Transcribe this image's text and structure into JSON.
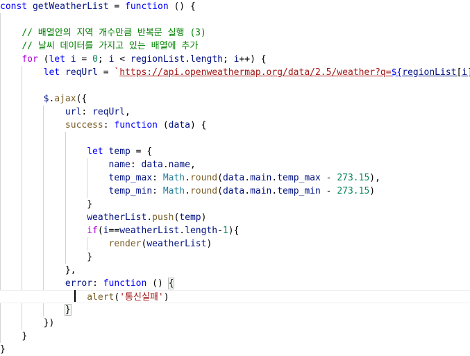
{
  "editor": {
    "lines": [
      [
        {
          "t": "const ",
          "c": "kw"
        },
        {
          "t": "getWeatherList",
          "c": "var"
        },
        {
          "t": " = ",
          "c": "pl"
        },
        {
          "t": "function",
          "c": "kw"
        },
        {
          "t": " () {",
          "c": "pl"
        }
      ],
      [],
      [
        {
          "t": "    "
        },
        {
          "t": "// 배열안의 지역 개수만큼 반복문 실행 (3)",
          "c": "cmt"
        }
      ],
      [
        {
          "t": "    "
        },
        {
          "t": "// 날씨 데이터를 가지고 있는 배열에 추가",
          "c": "cmt"
        }
      ],
      [
        {
          "t": "    "
        },
        {
          "t": "for",
          "c": "kw-ctrl"
        },
        {
          "t": " (",
          "c": "pl"
        },
        {
          "t": "let",
          "c": "kw"
        },
        {
          "t": " ",
          "c": "pl"
        },
        {
          "t": "i",
          "c": "var"
        },
        {
          "t": " = ",
          "c": "pl"
        },
        {
          "t": "0",
          "c": "num"
        },
        {
          "t": "; ",
          "c": "pl"
        },
        {
          "t": "i",
          "c": "var"
        },
        {
          "t": " < ",
          "c": "pl"
        },
        {
          "t": "regionList",
          "c": "var"
        },
        {
          "t": ".",
          "c": "pl"
        },
        {
          "t": "length",
          "c": "var"
        },
        {
          "t": "; ",
          "c": "pl"
        },
        {
          "t": "i",
          "c": "var"
        },
        {
          "t": "++) {",
          "c": "pl"
        }
      ],
      [
        {
          "t": "        "
        },
        {
          "t": "let",
          "c": "kw"
        },
        {
          "t": " ",
          "c": "pl"
        },
        {
          "t": "reqUrl",
          "c": "var"
        },
        {
          "t": " = ",
          "c": "pl"
        },
        {
          "t": "`",
          "c": "str"
        },
        {
          "t": "https://api.openweathermap.org/data/2.5/weather?q=",
          "c": "str url"
        },
        {
          "t": "${",
          "c": "tpl-expr url"
        },
        {
          "t": "regionList",
          "c": "var url"
        },
        {
          "t": "[",
          "c": "pl url"
        },
        {
          "t": "i",
          "c": "var url"
        },
        {
          "t": "]",
          "c": "pl url"
        },
        {
          "t": "}",
          "c": "tpl-expr url"
        }
      ],
      [],
      [
        {
          "t": "        "
        },
        {
          "t": "$",
          "c": "var"
        },
        {
          "t": ".",
          "c": "pl"
        },
        {
          "t": "ajax",
          "c": "fn"
        },
        {
          "t": "({",
          "c": "pl"
        }
      ],
      [
        {
          "t": "            "
        },
        {
          "t": "url",
          "c": "var"
        },
        {
          "t": ": ",
          "c": "pl"
        },
        {
          "t": "reqUrl",
          "c": "var"
        },
        {
          "t": ",",
          "c": "pl"
        }
      ],
      [
        {
          "t": "            "
        },
        {
          "t": "success",
          "c": "fn"
        },
        {
          "t": ": ",
          "c": "pl"
        },
        {
          "t": "function",
          "c": "kw"
        },
        {
          "t": " (",
          "c": "pl"
        },
        {
          "t": "data",
          "c": "var"
        },
        {
          "t": ") {",
          "c": "pl"
        }
      ],
      [],
      [
        {
          "t": "                "
        },
        {
          "t": "let",
          "c": "kw"
        },
        {
          "t": " ",
          "c": "pl"
        },
        {
          "t": "temp",
          "c": "var"
        },
        {
          "t": " = {",
          "c": "pl"
        }
      ],
      [
        {
          "t": "                    "
        },
        {
          "t": "name",
          "c": "var"
        },
        {
          "t": ": ",
          "c": "pl"
        },
        {
          "t": "data",
          "c": "var"
        },
        {
          "t": ".",
          "c": "pl"
        },
        {
          "t": "name",
          "c": "var"
        },
        {
          "t": ",",
          "c": "pl"
        }
      ],
      [
        {
          "t": "                    "
        },
        {
          "t": "temp_max",
          "c": "var"
        },
        {
          "t": ": ",
          "c": "pl"
        },
        {
          "t": "Math",
          "c": "cls"
        },
        {
          "t": ".",
          "c": "pl"
        },
        {
          "t": "round",
          "c": "fn"
        },
        {
          "t": "(",
          "c": "pl"
        },
        {
          "t": "data",
          "c": "var"
        },
        {
          "t": ".",
          "c": "pl"
        },
        {
          "t": "main",
          "c": "var"
        },
        {
          "t": ".",
          "c": "pl"
        },
        {
          "t": "temp_max",
          "c": "var"
        },
        {
          "t": " - ",
          "c": "pl"
        },
        {
          "t": "273.15",
          "c": "num"
        },
        {
          "t": "),",
          "c": "pl"
        }
      ],
      [
        {
          "t": "                    "
        },
        {
          "t": "temp_min",
          "c": "var"
        },
        {
          "t": ": ",
          "c": "pl"
        },
        {
          "t": "Math",
          "c": "cls"
        },
        {
          "t": ".",
          "c": "pl"
        },
        {
          "t": "round",
          "c": "fn"
        },
        {
          "t": "(",
          "c": "pl"
        },
        {
          "t": "data",
          "c": "var"
        },
        {
          "t": ".",
          "c": "pl"
        },
        {
          "t": "main",
          "c": "var"
        },
        {
          "t": ".",
          "c": "pl"
        },
        {
          "t": "temp_min",
          "c": "var"
        },
        {
          "t": " - ",
          "c": "pl"
        },
        {
          "t": "273.15",
          "c": "num"
        },
        {
          "t": ")",
          "c": "pl"
        }
      ],
      [
        {
          "t": "                "
        },
        {
          "t": "}",
          "c": "pl"
        }
      ],
      [
        {
          "t": "                "
        },
        {
          "t": "weatherList",
          "c": "var"
        },
        {
          "t": ".",
          "c": "pl"
        },
        {
          "t": "push",
          "c": "fn"
        },
        {
          "t": "(",
          "c": "pl"
        },
        {
          "t": "temp",
          "c": "var"
        },
        {
          "t": ")",
          "c": "pl"
        }
      ],
      [
        {
          "t": "                "
        },
        {
          "t": "if",
          "c": "kw-ctrl"
        },
        {
          "t": "(",
          "c": "pl"
        },
        {
          "t": "i",
          "c": "var"
        },
        {
          "t": "==",
          "c": "pl"
        },
        {
          "t": "weatherList",
          "c": "var"
        },
        {
          "t": ".",
          "c": "pl"
        },
        {
          "t": "length",
          "c": "var"
        },
        {
          "t": "-",
          "c": "pl"
        },
        {
          "t": "1",
          "c": "num"
        },
        {
          "t": "){",
          "c": "pl"
        }
      ],
      [
        {
          "t": "                    "
        },
        {
          "t": "render",
          "c": "fn"
        },
        {
          "t": "(",
          "c": "pl"
        },
        {
          "t": "weatherList",
          "c": "var"
        },
        {
          "t": ")",
          "c": "pl"
        }
      ],
      [
        {
          "t": "                "
        },
        {
          "t": "}",
          "c": "pl"
        }
      ],
      [
        {
          "t": "            "
        },
        {
          "t": "},",
          "c": "pl"
        }
      ],
      [
        {
          "t": "            "
        },
        {
          "t": "error",
          "c": "var"
        },
        {
          "t": ": ",
          "c": "pl"
        },
        {
          "t": "function",
          "c": "kw"
        },
        {
          "t": " () ",
          "c": "pl"
        },
        {
          "t": "{",
          "c": "pl bracket-box"
        }
      ],
      [
        {
          "t": "                "
        },
        {
          "t": "alert",
          "c": "fn"
        },
        {
          "t": "(",
          "c": "pl"
        },
        {
          "t": "'통신실패'",
          "c": "str"
        },
        {
          "t": ")",
          "c": "pl"
        }
      ],
      [
        {
          "t": "            "
        },
        {
          "t": "}",
          "c": "pl bracket-box"
        }
      ],
      [
        {
          "t": "        "
        },
        {
          "t": "})",
          "c": "pl"
        }
      ],
      [
        {
          "t": "    "
        },
        {
          "t": "}",
          "c": "pl"
        }
      ],
      [
        {
          "t": "}",
          "c": "pl"
        }
      ]
    ]
  },
  "colors": {
    "background": "#ffffff",
    "keyword": "#0000ff",
    "control_keyword": "#af00db",
    "function": "#795e26",
    "variable": "#001080",
    "class": "#267f99",
    "number": "#098658",
    "string": "#a31515",
    "comment": "#008000"
  }
}
